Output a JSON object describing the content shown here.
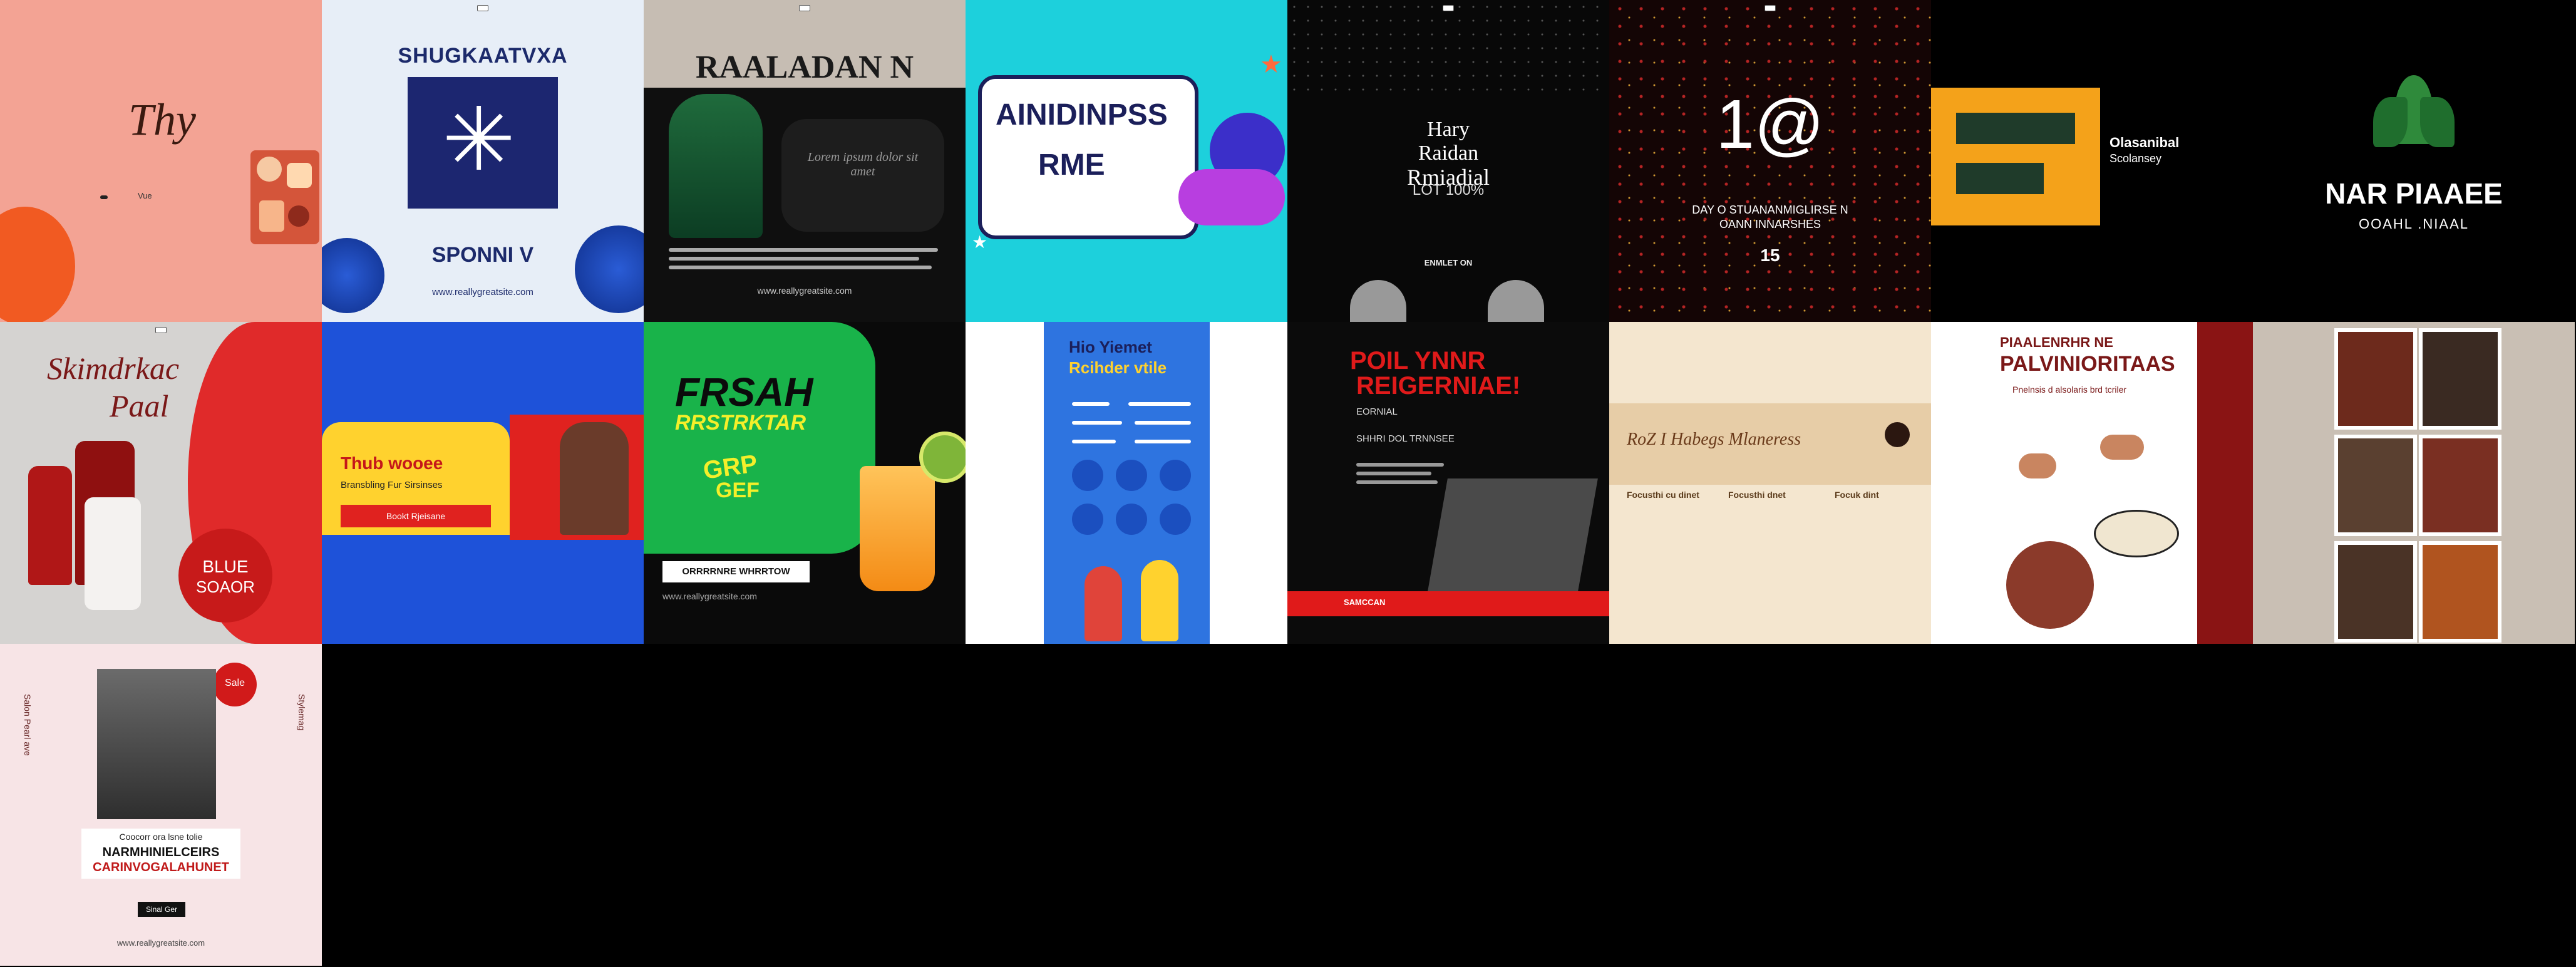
{
  "gallery": {
    "t1": {
      "title": "Thy",
      "caption": "Vue"
    },
    "t2": {
      "title": "SHUGKAATVXA",
      "sub": "SPONNI V",
      "footer": "www.reallygreatsite.com"
    },
    "t3": {
      "title": "RAALADAN N",
      "body": "Lorem ipsum dolor sit amet",
      "footer": "www.reallygreatsite.com"
    },
    "t4": {
      "line1": "AINIDINPSS",
      "line2": "RME"
    },
    "t5": {
      "line1": "Hary",
      "line2": "Raidan",
      "line3": "Rmiadial",
      "line4": "LOT 100%",
      "label": "ENMLET ON"
    },
    "t6": {
      "big": "1@",
      "line": "DAY O STUANANMIGLIRSE N",
      "line2": "OANN INNARSHES",
      "num": "15"
    },
    "t7": {
      "line1": "Olasanibal",
      "line2": "Scolansey"
    },
    "t8": {
      "title": "NAR PIAAEE",
      "sub": "OOAHL .NIAAL"
    },
    "t9": {
      "title": "Skimdrkac",
      "title2": "Paal",
      "badge1": "BLUE",
      "badge2": "SOAOR"
    },
    "t10": {
      "title": "Thub wooee",
      "sub": "Bransbling Fur Sirsinses",
      "button": "Bookt Rjeisane"
    },
    "t11": {
      "title": "FRSAH",
      "sub": "RRSTRKTAR",
      "sticker1": "GRP",
      "sticker2": "GEF",
      "cta": "ORRRRNRE WHRRTOW",
      "footer": "www.reallygreatsite.com"
    },
    "t12": {
      "title1": "Hio Yiemet",
      "title2": "Rcihder vtile"
    },
    "t13": {
      "title1": "POIL YNNR",
      "title2": "REIGERNIAE!",
      "label": "EORNIAL",
      "subline": "SHHRI DOL TRNNSEE",
      "strip": "SAMCCAN"
    },
    "t14": {
      "script": "RoZ I Habegs Mlaneress",
      "col1": "Focusthi cu dinet",
      "col2": "Focusthi dnet",
      "col3": "Focuk dint"
    },
    "t15": {
      "kicker": "PIAALENRHR NE",
      "title": "PALVINIORITAAS",
      "sub": "Pnelnsis d alsolaris brd tcriler"
    },
    "t16": {},
    "t17": {
      "badge": "Sale",
      "line1": "Coocorr ora lsne tolie",
      "line2": "NARMHINIELCEIRS",
      "line3": "CARINVOGALAHUNET",
      "button": "Sinal Ger",
      "footer": "www.reallygreatsite.com",
      "side_left": "Salon Pearl ave",
      "side_right": "Stylemag"
    },
    "colors": {
      "accent_red": "#e01a1a",
      "blue": "#1d4fe0",
      "cyan": "#1dd0dc",
      "green": "#19b34a",
      "gold": "#f5a623",
      "cream": "#f4e6cf"
    }
  }
}
